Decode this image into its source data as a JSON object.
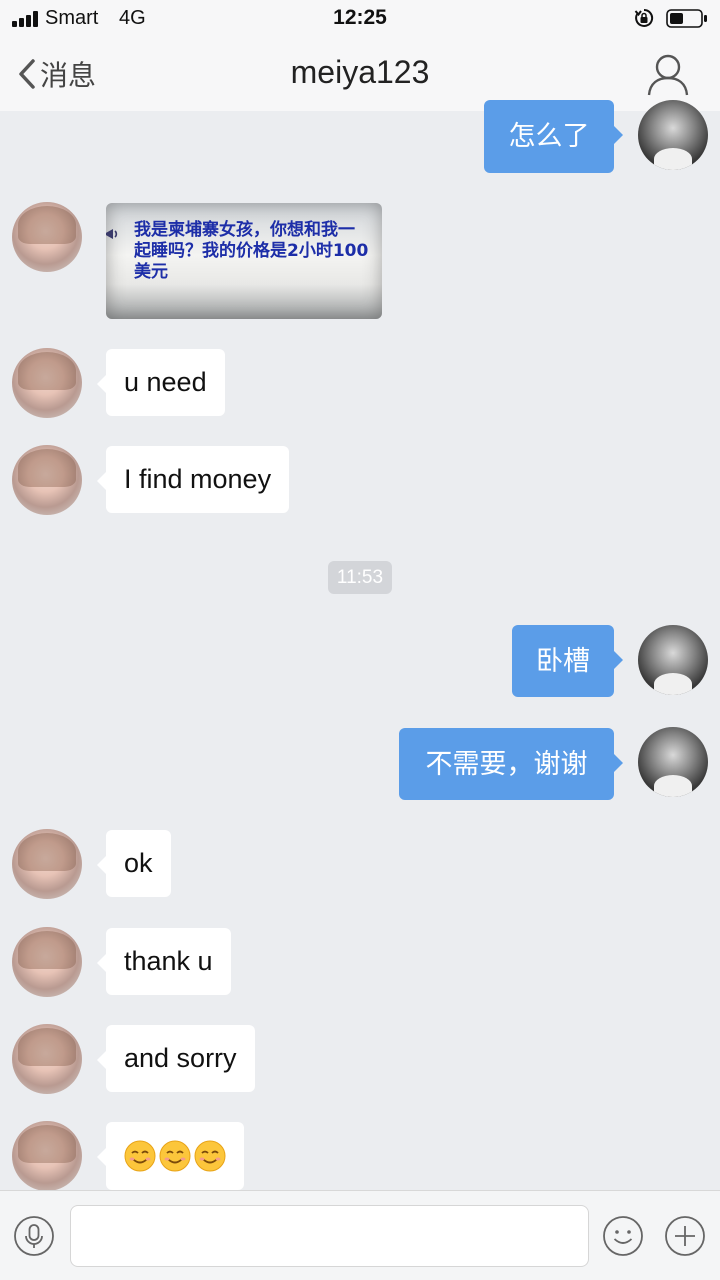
{
  "status_bar": {
    "carrier": "Smart",
    "network": "4G",
    "time": "12:25"
  },
  "nav": {
    "back_label": "消息",
    "title": "meiya123",
    "icons": {
      "back": "chevron-left-icon",
      "profile": "person-icon"
    }
  },
  "messages": [
    {
      "direction": "outgoing",
      "type": "text",
      "text": "怎么了"
    },
    {
      "direction": "incoming",
      "type": "image",
      "image_text": "我是柬埔寨女孩，你想和我一起睡吗？我的价格是2小时100美元"
    },
    {
      "direction": "incoming",
      "type": "text",
      "text": "u need"
    },
    {
      "direction": "incoming",
      "type": "text",
      "text": "I find money"
    },
    {
      "type": "timestamp",
      "text": "11:53"
    },
    {
      "direction": "outgoing",
      "type": "text",
      "text": "卧槽"
    },
    {
      "direction": "outgoing",
      "type": "text",
      "text": "不需要，谢谢"
    },
    {
      "direction": "incoming",
      "type": "text",
      "text": "ok"
    },
    {
      "direction": "incoming",
      "type": "text",
      "text": "thank u"
    },
    {
      "direction": "incoming",
      "type": "text",
      "text": "and sorry"
    },
    {
      "direction": "incoming",
      "type": "emoji",
      "emoji": [
        "smiling-face-icon",
        "smiling-face-icon",
        "smiling-face-icon"
      ]
    }
  ],
  "input_bar": {
    "placeholder": "",
    "value": "",
    "icons": [
      "microphone-icon",
      "emoji-face-icon",
      "plus-icon"
    ]
  },
  "colors": {
    "background": "#ebedf0",
    "outgoing_bubble": "#5b9de8",
    "incoming_bubble": "#ffffff",
    "bar": "#f7f7f8"
  }
}
